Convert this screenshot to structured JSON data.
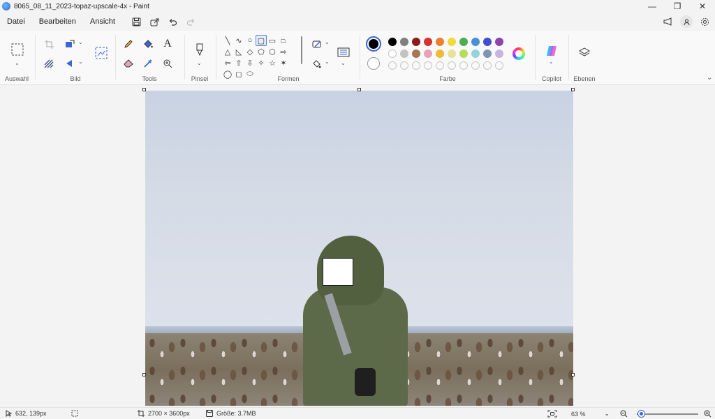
{
  "window": {
    "title": "8065_08_11_2023-topaz-upscale-4x - Paint",
    "controls": {
      "minimize": "—",
      "restore": "❐",
      "close": "✕"
    }
  },
  "menu": {
    "file": "Datei",
    "edit": "Bearbeiten",
    "view": "Ansicht"
  },
  "ribbon": {
    "groups": {
      "selection": "Auswahl",
      "image": "Bild",
      "tools": "Tools",
      "brushes": "Pinsel",
      "shapes": "Formen",
      "colors": "Farbe",
      "copilot": "Copilot",
      "layers": "Ebenen"
    },
    "shapes": [
      "╲",
      "∿",
      "○",
      "▢",
      "▭",
      "⏢",
      "△",
      "◺",
      "◇",
      "⬠",
      "⬡",
      "⇨",
      "⇦",
      "⇧",
      "⇩",
      "✧",
      "☆",
      "✶",
      "◯",
      "◻",
      "⬭"
    ],
    "palette": {
      "primary": "#000000",
      "secondary": "#ffffff",
      "row1": [
        "#000000",
        "#7f7f7f",
        "#8b1a1a",
        "#d9312c",
        "#ec7f30",
        "#f2d93a",
        "#4cae4f",
        "#4a90d9",
        "#3f4fcf",
        "#8e44ad"
      ],
      "row2": [
        "#ffffff",
        "#c3c3c3",
        "#a5775a",
        "#e9a3b6",
        "#f2b935",
        "#e6e29e",
        "#b5dc5a",
        "#93d2df",
        "#7f93b3",
        "#c5b5e0"
      ]
    }
  },
  "status": {
    "cursor_pos": "632, 139px",
    "canvas_size": "2700 × 3600px",
    "file_size": "Größe: 3.7MB",
    "zoom": "63 %",
    "zoom_level": 0.07
  }
}
